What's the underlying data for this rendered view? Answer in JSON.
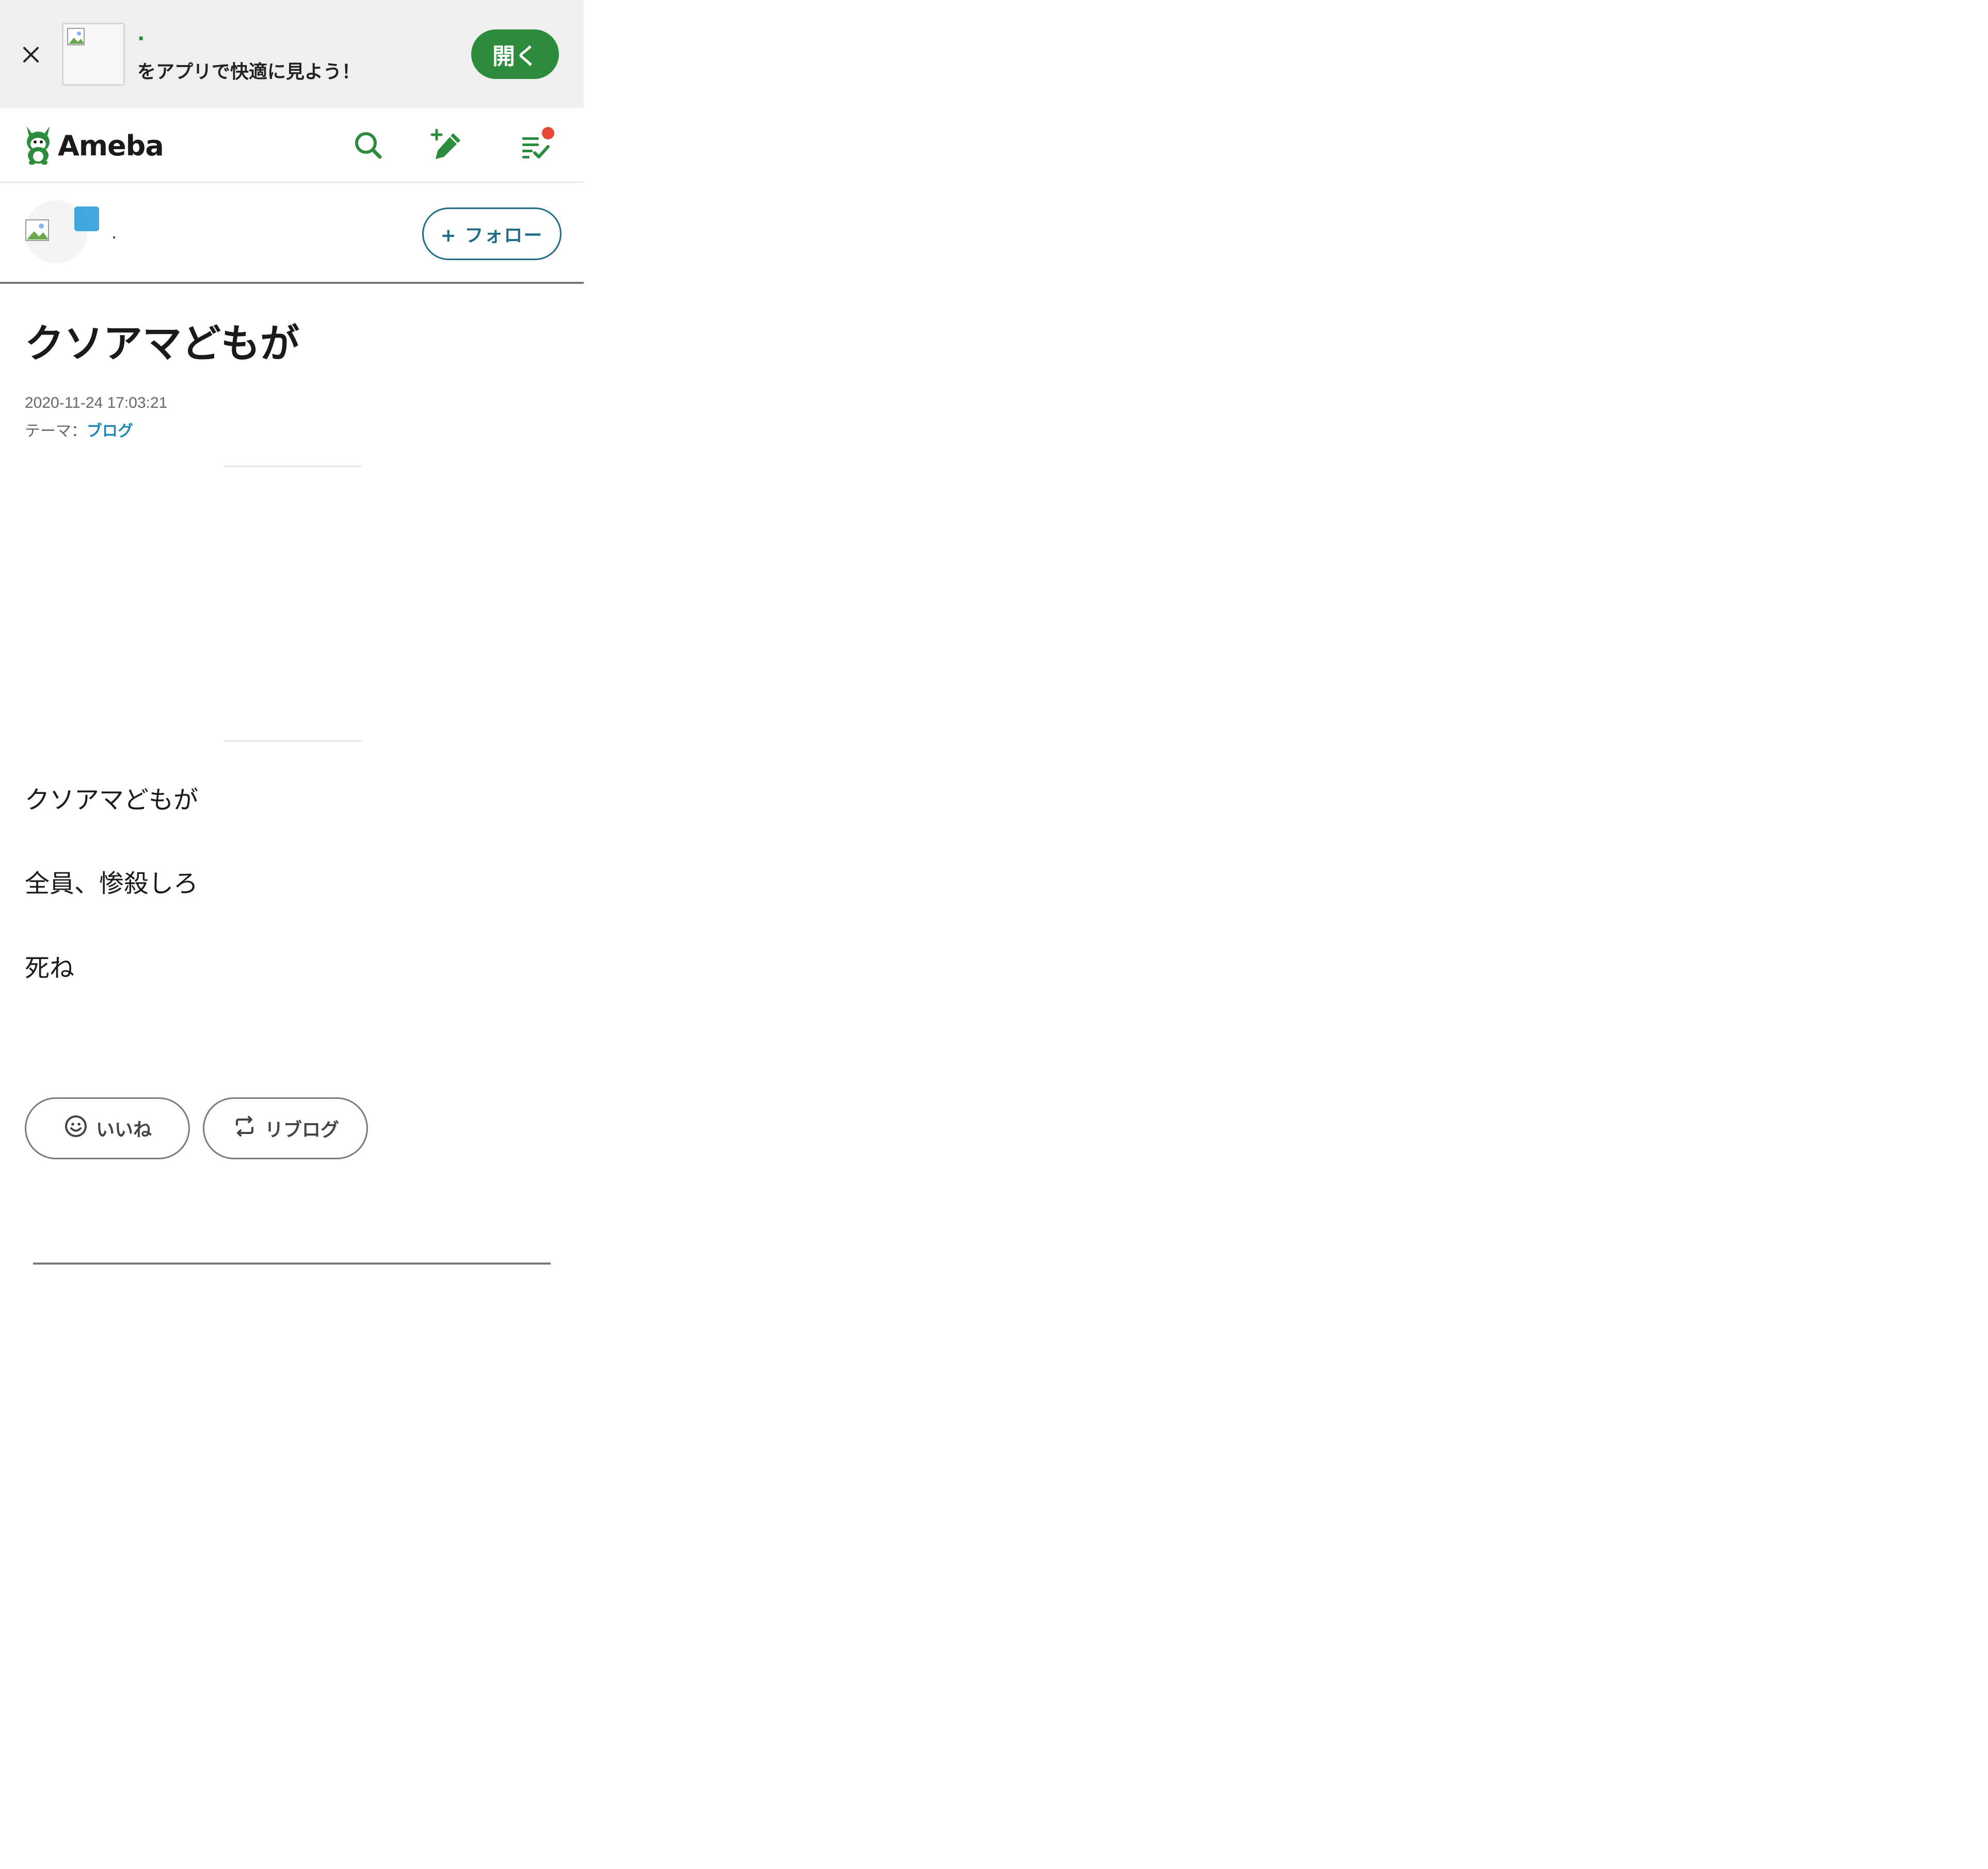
{
  "app_banner": {
    "app_name": ".",
    "message": "をアプリで快適に見よう！",
    "open_label": "開く",
    "close_icon": "close-icon",
    "app_icon": "app-icon-image"
  },
  "header": {
    "logo_text": "Ameba",
    "logo_icon": "ameba-mascot-icon",
    "icons": [
      "search-icon",
      "write-post-icon",
      "reading-list-icon"
    ],
    "accent_color": "#2d8c3c",
    "notification_color": "#e84a36"
  },
  "blogger": {
    "name": ".",
    "follow_label": "+ フォロー",
    "follow_color": "#1f6c87"
  },
  "article": {
    "title": "クソアマどもが",
    "date": "2020-11-24 17:03:21",
    "theme_label": "テーマ：",
    "theme_value": "ブログ",
    "theme_color": "#1f86b8",
    "body": [
      "クソアマどもが",
      "全員、惨殺しろ",
      "死ね"
    ]
  },
  "reactions": {
    "like_label": "いいね",
    "like_icon": "smiley-icon",
    "reblog_label": "リブログ",
    "reblog_icon": "reblog-icon"
  }
}
